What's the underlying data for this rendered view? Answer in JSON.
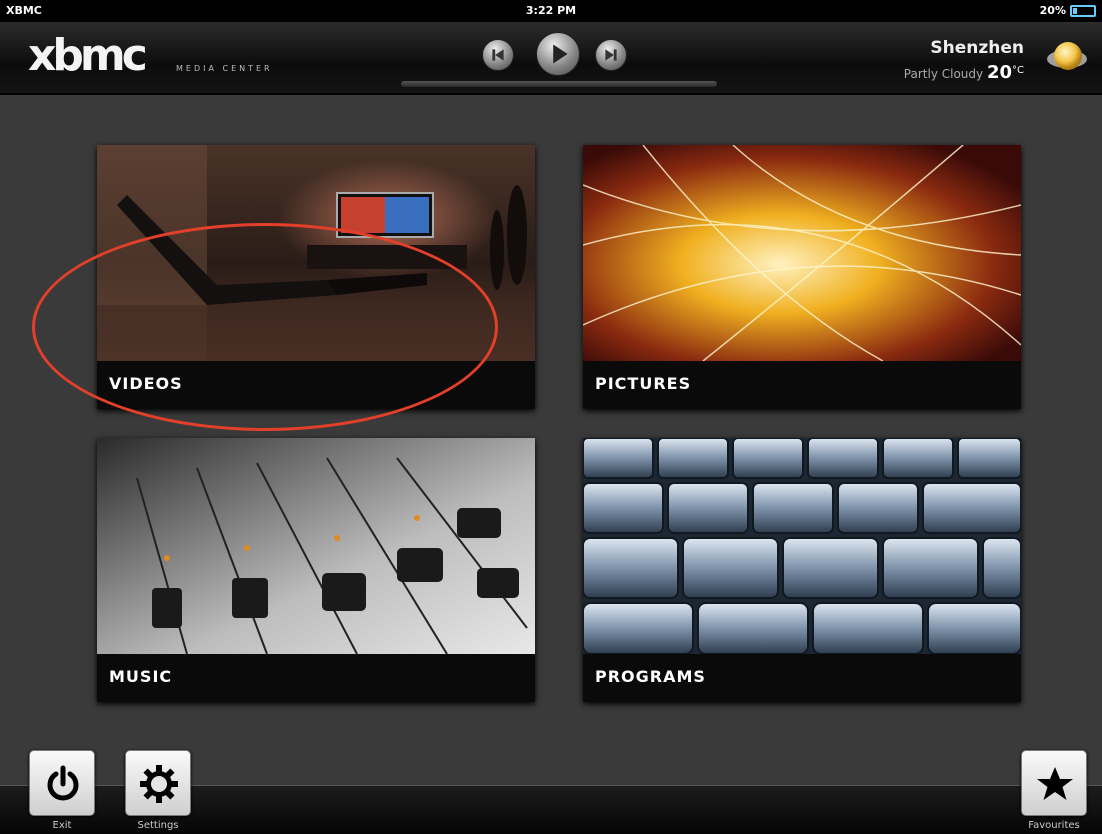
{
  "status": {
    "carrier": "XBMC",
    "time": "3:22 PM",
    "battery": "20%",
    "battery_level": 0.2
  },
  "header": {
    "logo_text": "xbmc",
    "logo_subtitle": "MEDIA CENTER",
    "transport": {
      "icons": [
        "previous-icon",
        "play-icon",
        "next-icon"
      ]
    },
    "weather": {
      "city": "Shenzhen",
      "condition": "Partly Cloudy",
      "temperature": "20",
      "unit": "°C",
      "icon": "sun-icon"
    }
  },
  "tiles": [
    {
      "label": "VIDEOS"
    },
    {
      "label": "PICTURES"
    },
    {
      "label": "MUSIC"
    },
    {
      "label": "PROGRAMS"
    }
  ],
  "dock": {
    "exit": {
      "label": "Exit",
      "icon": "power-icon"
    },
    "settings": {
      "label": "Settings",
      "icon": "gear-icon"
    },
    "favourites": {
      "label": "Favourites",
      "icon": "star-icon"
    }
  },
  "colors": {
    "background": "#3a3a3a",
    "highlight_ring": "#e2402a",
    "battery": "#66ccff"
  }
}
